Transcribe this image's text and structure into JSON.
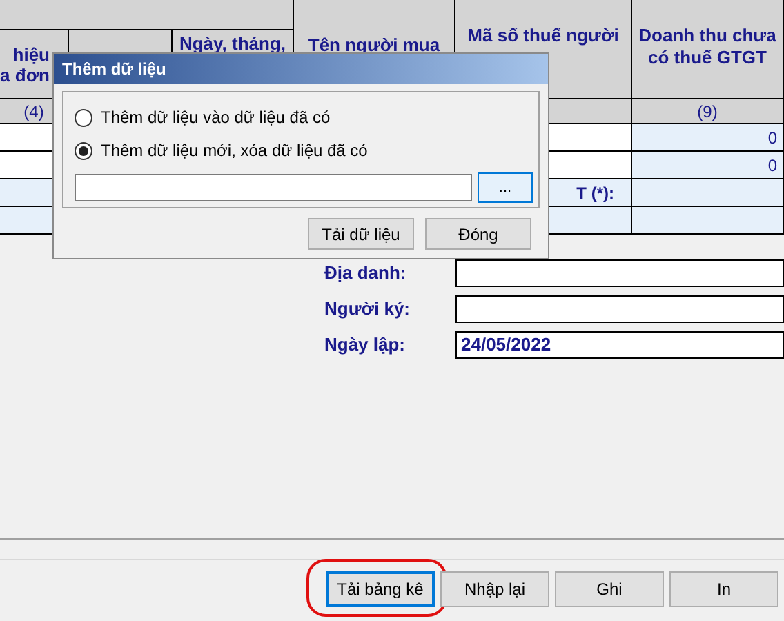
{
  "table": {
    "columns": [
      {
        "lines": [
          "hiệu",
          "a đơn"
        ],
        "number": "(4)"
      },
      {},
      {
        "lines": [
          "Ngày, tháng,"
        ]
      },
      {
        "lines": [
          "Tên người mua"
        ]
      },
      {
        "lines": [
          "Mã số thuế người"
        ]
      },
      {
        "lines": [
          "Doanh thu chưa",
          "có thuế GTGT"
        ],
        "number": "(9)"
      }
    ],
    "rows": [
      {
        "shaded": false,
        "value": "0"
      },
      {
        "shaded": false,
        "value": "0"
      },
      {
        "shaded": true,
        "label": "T (*):"
      },
      {
        "shaded": true
      }
    ]
  },
  "form": [
    {
      "label": "Địa danh:"
    },
    {
      "label": "Người ký:"
    },
    {
      "label": "Ngày lập:",
      "value": "24/05/2022"
    }
  ],
  "footer_buttons": [
    {
      "label": "Tải bảng kê",
      "focused": true,
      "highlighted": true
    },
    {
      "label": "Nhập lại",
      "focused": false,
      "highlighted": false
    },
    {
      "label": "Ghi",
      "focused": false,
      "highlighted": false
    },
    {
      "label": "In",
      "focused": false,
      "highlighted": false
    }
  ],
  "dialog": {
    "title": "Thêm dữ liệu",
    "options": [
      {
        "label": "Thêm dữ liệu vào dữ liệu đã có",
        "selected": false
      },
      {
        "label": "Thêm dữ liệu mới, xóa dữ liệu đã có",
        "selected": true
      }
    ],
    "browse": "...",
    "buttons": [
      "Tải dữ liệu",
      "Đóng"
    ]
  }
}
